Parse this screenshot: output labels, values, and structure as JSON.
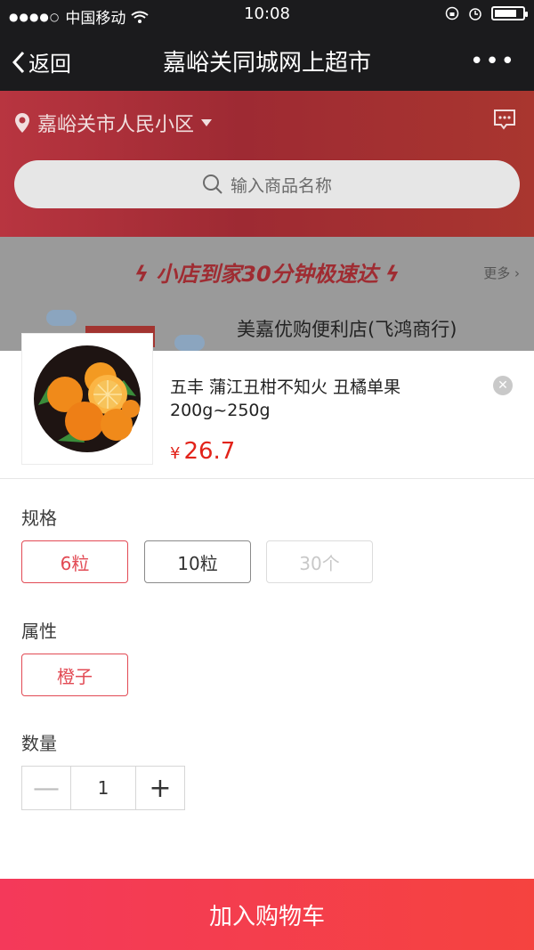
{
  "status_bar": {
    "carrier": "中国移动",
    "time": "10:08"
  },
  "nav": {
    "back_label": "返回",
    "title": "嘉峪关同城网上超市",
    "more_label": "•••"
  },
  "header": {
    "location": "嘉峪关市人民小区",
    "search_placeholder": "输入商品名称"
  },
  "shop": {
    "promo": "小店到家30分钟极速达",
    "more_label": "更多",
    "name": "美嘉优购便利店(飞鸿商行)"
  },
  "product": {
    "name": "五丰 蒲江丑柑不知火 丑橘单果 200g~250g",
    "currency": "¥",
    "price": "26.7"
  },
  "spec": {
    "label": "规格",
    "options": [
      {
        "label": "6粒",
        "state": "selected"
      },
      {
        "label": "10粒",
        "state": "normal"
      },
      {
        "label": "30个",
        "state": "disabled"
      }
    ]
  },
  "attr": {
    "label": "属性",
    "options": [
      {
        "label": "橙子",
        "state": "selected"
      }
    ]
  },
  "quantity": {
    "label": "数量",
    "value": "1",
    "minus": "—",
    "plus": "+"
  },
  "cta": {
    "add_to_cart": "加入购物车"
  },
  "colors": {
    "accent": "#e2231a",
    "header_red": "#a9362f",
    "nav_dark": "#1b1b1d"
  }
}
